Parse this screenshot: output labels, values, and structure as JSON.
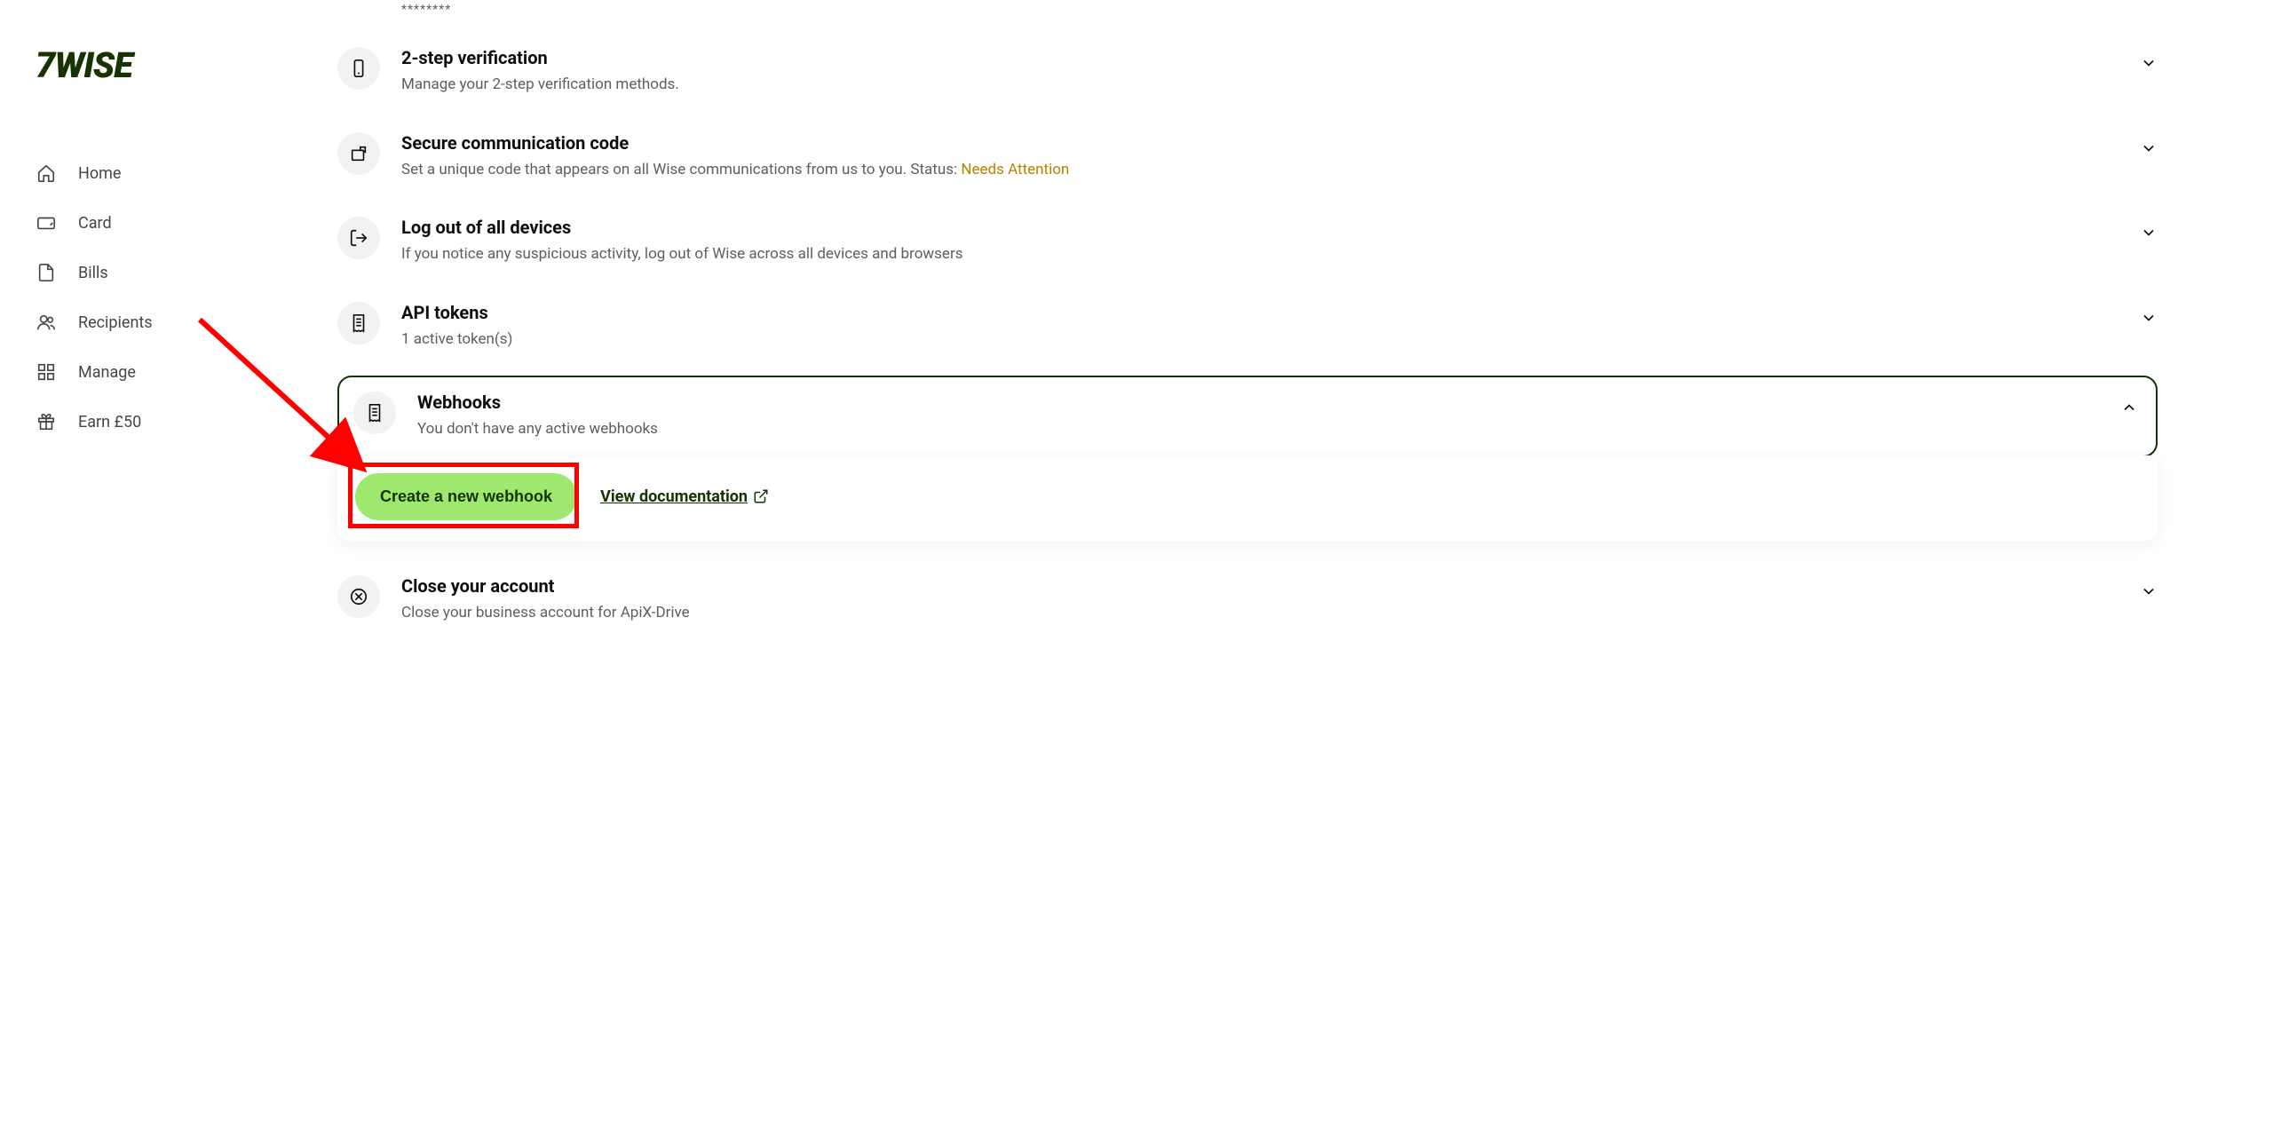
{
  "brand": "7WISE",
  "sidebar": {
    "items": [
      {
        "label": "Home"
      },
      {
        "label": "Card"
      },
      {
        "label": "Bills"
      },
      {
        "label": "Recipients"
      },
      {
        "label": "Manage"
      },
      {
        "label": "Earn £50"
      }
    ]
  },
  "top_masked": "********",
  "sections": {
    "two_step": {
      "title": "2-step verification",
      "sub": "Manage your 2-step verification methods."
    },
    "secure_code": {
      "title": "Secure communication code",
      "sub": "Set a unique code that appears on all Wise communications from us to you. Status: ",
      "status": "Needs Attention"
    },
    "logout_all": {
      "title": "Log out of all devices",
      "sub": "If you notice any suspicious activity, log out of Wise across all devices and browsers"
    },
    "api_tokens": {
      "title": "API tokens",
      "sub": "1 active token(s)"
    },
    "webhooks": {
      "title": "Webhooks",
      "sub": "You don't have any active webhooks",
      "create_label": "Create a new webhook",
      "doc_label": "View documentation"
    },
    "close_account": {
      "title": "Close your account",
      "sub": "Close your business account for ApiX-Drive"
    }
  }
}
